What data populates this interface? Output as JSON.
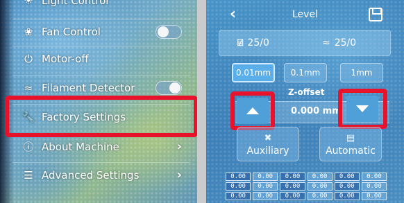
{
  "left_menu": {
    "items": [
      {
        "key": "light",
        "label": "Light Control",
        "icon": "bulb-icon",
        "control": "none"
      },
      {
        "key": "fan",
        "label": "Fan Control",
        "icon": "fan-icon",
        "control": "toggle",
        "toggle_on": false
      },
      {
        "key": "motor",
        "label": "Motor-off",
        "icon": "power-icon",
        "control": "none"
      },
      {
        "key": "filament",
        "label": "Filament Detector",
        "icon": "filament-icon",
        "control": "toggle",
        "toggle_on": true
      },
      {
        "key": "factory",
        "label": "Factory Settings",
        "icon": "wrench-icon",
        "control": "none",
        "highlighted": true
      },
      {
        "key": "about",
        "label": "About Machine",
        "icon": "info-icon",
        "control": "chevron"
      },
      {
        "key": "advanced",
        "label": "Advanced Settings",
        "icon": "sliders-icon",
        "control": "chevron"
      }
    ]
  },
  "level_screen": {
    "title": "Level",
    "back_icon": "back-chevron-icon",
    "save_icon": "save-icon",
    "nozzle_temp": "25/0",
    "bed_temp": "25/0",
    "step_options": [
      "0.01mm",
      "0.1mm",
      "1mm"
    ],
    "step_selected": "0.01mm",
    "zoffset_label": "Z-offset",
    "zoffset_value": "0.000 mm",
    "auxiliary_label": "Auxiliary",
    "automatic_label": "Automatic",
    "mesh_values": [
      [
        "0.00",
        "0.00",
        "0.00",
        "0.00",
        "0.00",
        "0.00"
      ],
      [
        "0.00",
        "0.00",
        "0.00",
        "0.00",
        "0.00",
        "0.00"
      ],
      [
        "0.00",
        "0.00",
        "0.00",
        "0.00",
        "0.00",
        "0.00"
      ]
    ]
  },
  "colors": {
    "highlight_red": "#e8122a",
    "screen_blue": "#3d7fb8"
  }
}
